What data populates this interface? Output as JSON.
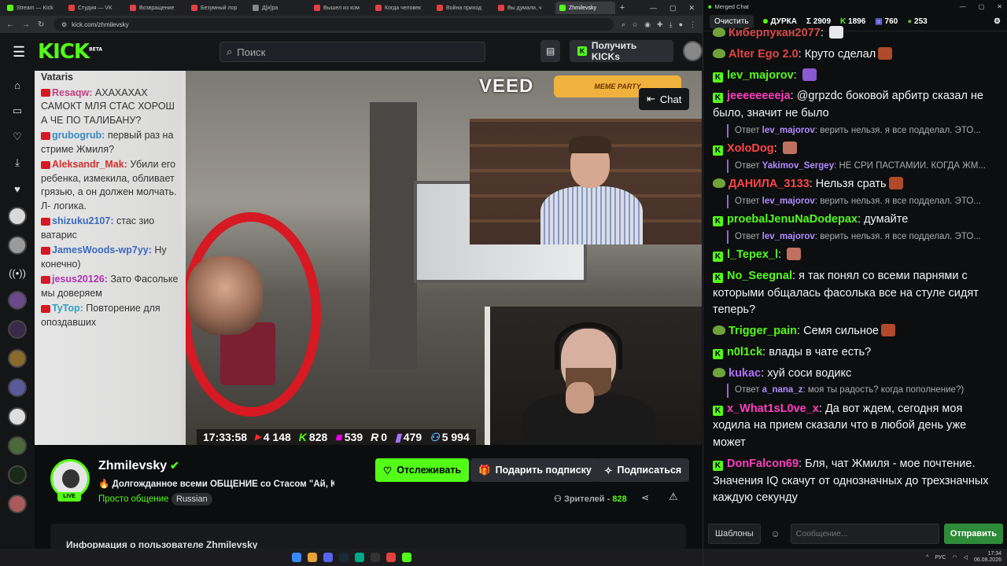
{
  "browser": {
    "tabs": [
      {
        "label": "Stream — Kick",
        "color": "#53fc18",
        "active": false
      },
      {
        "label": "Студия — VK",
        "color": "#e34141",
        "active": false
      },
      {
        "label": "Возвращение",
        "color": "#e34141",
        "active": false
      },
      {
        "label": "Безумный лор",
        "color": "#e34141",
        "active": false
      },
      {
        "label": "Д[и]ра",
        "color": "#888888",
        "active": false
      },
      {
        "label": "Вышел из ком",
        "color": "#e34141",
        "active": false
      },
      {
        "label": "Когда человек",
        "color": "#e34141",
        "active": false
      },
      {
        "label": "Война приход",
        "color": "#e34141",
        "active": false
      },
      {
        "label": "Вы думали, ч",
        "color": "#e34141",
        "active": false
      },
      {
        "label": "Zhmilevsky",
        "color": "#53fc18",
        "active": true
      }
    ],
    "url": "kick.com/zhmilevsky"
  },
  "kick": {
    "logo": "KICK",
    "logo_sup": "BETA",
    "search_placeholder": "Поиск",
    "get_kicks": "Получить KICKs"
  },
  "overlay": {
    "veed": "VEED",
    "meme_party": "MEME PARTY",
    "chat_button": "Chat",
    "chat_lines": [
      {
        "name": "",
        "text": "Vataris",
        "color": "#333333"
      },
      {
        "name": "Resaqw",
        "text": "АХАХАХАХ САМОКТ МЛЯ СТАС ХОРОШ А ЧЕ ПО ТАЛИБАНУ?",
        "color": "#c04080"
      },
      {
        "name": "grubogrub",
        "text": "первый раз на стриме Жмиля?",
        "color": "#3a8ac0"
      },
      {
        "name": "Aleksandr_Mak",
        "text": "Убили его ребенка, измекила, обливает грязью, а он должен молчать. Л- логика.",
        "color": "#d03030"
      },
      {
        "name": "shizuku2107",
        "text": "стас зио ватарис",
        "color": "#3a6ac0"
      },
      {
        "name": "JamesWoods-wp7yy",
        "text": "Ну конечно)",
        "color": "#3a6ac0"
      },
      {
        "name": "jesus20126",
        "text": "Зато Фасольке мы доверяем",
        "color": "#b030b0"
      },
      {
        "name": "TyTop",
        "text": "Повторение для опоздавших",
        "color": "#30a0c0"
      }
    ],
    "stats": {
      "time": "17:33:58",
      "youtube": "4 148",
      "kick": "828",
      "vk": "539",
      "rutube": "0",
      "twitch": "479",
      "total": "5 994"
    }
  },
  "channel": {
    "name": "Zhmilevsky",
    "live": "LIVE",
    "title": "Долгожданное всеми ОБЩЕНИЕ со Стасом \"Ай, К...",
    "category": "Просто общение",
    "tag": "Russian",
    "follow": "Отслеживать",
    "gift": "Подарить подписку",
    "subscribe": "Подписаться",
    "viewers_label": "Зрителей -",
    "viewers_value": "828",
    "about": "Информация о пользователе Zhmilevsky"
  },
  "merged_chat": {
    "window_title": "Merged Chat",
    "clear": "Очистить",
    "channel": "ДУРКА",
    "total": "Σ 2909",
    "kick": "1896",
    "vk": "760",
    "other": "253",
    "messages": [
      {
        "platform": "vk",
        "name": "Киберпукан2077",
        "color": "#d04a4a",
        "text": ""
      },
      {
        "platform": "vk",
        "name": "Alter Ego 2.0",
        "color": "#e04545",
        "text": "Круто сделал"
      },
      {
        "platform": "kick",
        "name": "lev_majorov",
        "color": "#53fc18",
        "text": ""
      },
      {
        "platform": "kick",
        "name": "jeeeeeeeeja",
        "color": "#ff3fbf",
        "text": "@grpzdc боковой арбитр сказал не было, значит не было"
      },
      {
        "platform": "reply",
        "reply_name": "lev_majorov",
        "reply_text": "верить нельзя. я все подделал. ЭТО..."
      },
      {
        "platform": "kick",
        "name": "XoloDog",
        "color": "#ff4545",
        "text": ""
      },
      {
        "platform": "reply",
        "reply_name": "Yakimov_Sergey",
        "reply_text": "НЕ СРИ ПАСТАМИИ. КОГДА ЖМ..."
      },
      {
        "platform": "vk",
        "name": "ДАНИЛА_3133",
        "color": "#ff4545",
        "text": "Нельзя срать"
      },
      {
        "platform": "reply",
        "reply_name": "lev_majorov",
        "reply_text": "верить нельзя. я все подделал. ЭТО..."
      },
      {
        "platform": "kick",
        "name": "proebalJenuNaDodepax",
        "color": "#53fc18",
        "text": "думайте"
      },
      {
        "platform": "reply",
        "reply_name": "lev_majorov",
        "reply_text": "верить нельзя. я все подделал. ЭТО..."
      },
      {
        "platform": "kick",
        "name": "l_Tepex_l",
        "color": "#53fc18",
        "text": ""
      },
      {
        "platform": "kick",
        "name": "No_Seegnal",
        "color": "#53fc18",
        "text": "я так понял со всеми парнями с которыми общалась фасолька все на стуле сидят теперь?"
      },
      {
        "platform": "vk",
        "name": "Trigger_pain",
        "color": "#53fc18",
        "text": "Семя сильное"
      },
      {
        "platform": "kick",
        "name": "n0l1ck",
        "color": "#53fc18",
        "text": "влады в чате есть?"
      },
      {
        "platform": "vk",
        "name": "kukac",
        "color": "#b070ff",
        "text": "хуй соси водикс"
      },
      {
        "platform": "reply",
        "reply_name": "a_nana_z",
        "reply_text": "моя ты радость? когда пополнение?)"
      },
      {
        "platform": "kick",
        "name": "x_What1sL0ve_x",
        "color": "#ff3fbf",
        "text": "Да вот ждем, сегодня моя ходила на прием сказали что в любой день уже может"
      },
      {
        "platform": "kick",
        "name": "DonFalcon69",
        "color": "#ff3fbf",
        "text": "Бля, чат Жмиля - мое почтение. Значения IQ скачут от однозначных до трехзначных каждую секунду"
      }
    ],
    "templates": "Шаблоны",
    "input_placeholder": "Сообщение...",
    "send": "Отправить"
  },
  "taskbar": {
    "lang": "РУС",
    "time": "17:34",
    "date": "06.08.2026"
  }
}
